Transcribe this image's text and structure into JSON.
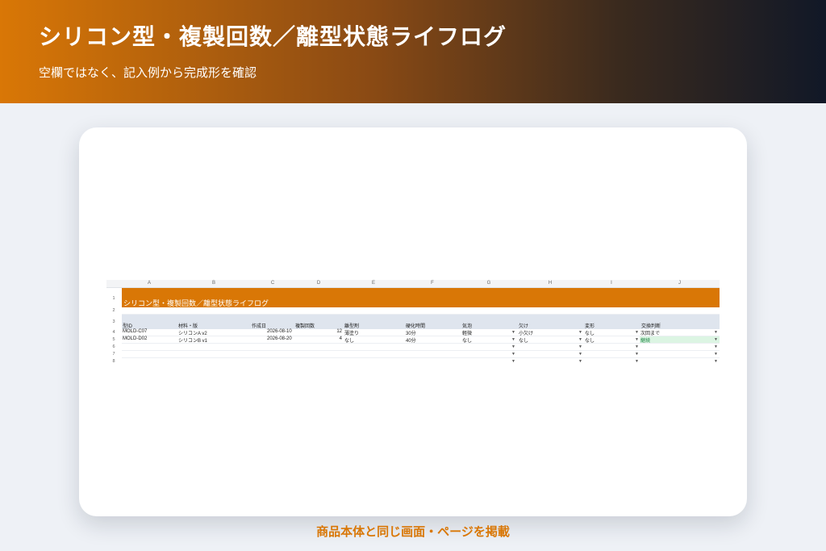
{
  "header": {
    "title": "シリコン型・複製回数／離型状態ライフログ",
    "subtitle": "空欄ではなく、記入例から完成形を確認"
  },
  "sheet": {
    "columns": [
      "A",
      "B",
      "C",
      "D",
      "E",
      "F",
      "G",
      "H",
      "I",
      "J"
    ],
    "row_numbers": [
      "1",
      "2",
      "3",
      "4",
      "5",
      "6",
      "7",
      "8"
    ],
    "banner_title": "シリコン型・複製回数／離型状態ライフログ",
    "headers": [
      "型ID",
      "材料・版",
      "作成日",
      "複製回数",
      "離型剤",
      "硬化時間",
      "気泡",
      "欠け",
      "変形",
      "交換判断"
    ],
    "rows": [
      {
        "id": "MOLD-C07",
        "material": "シリコンA v2",
        "date": "2026-08-10",
        "count": "12",
        "release": "薄塗り",
        "cure": "30分",
        "bubbles": "軽微",
        "chip": "小欠け",
        "deform": "なし",
        "judge": "次回まで"
      },
      {
        "id": "MOLD-D02",
        "material": "シリコンB v1",
        "date": "2026-08-20",
        "count": "4",
        "release": "なし",
        "cure": "40分",
        "bubbles": "なし",
        "chip": "なし",
        "deform": "なし",
        "judge": "継続"
      }
    ],
    "dropdown_glyph": "▼"
  },
  "footer": {
    "text": "商品本体と同じ画面・ページを掲載"
  },
  "colors": {
    "accent": "#d97706",
    "header_row": "#dfe5ee",
    "continue_highlight": "#dcf5e3"
  }
}
